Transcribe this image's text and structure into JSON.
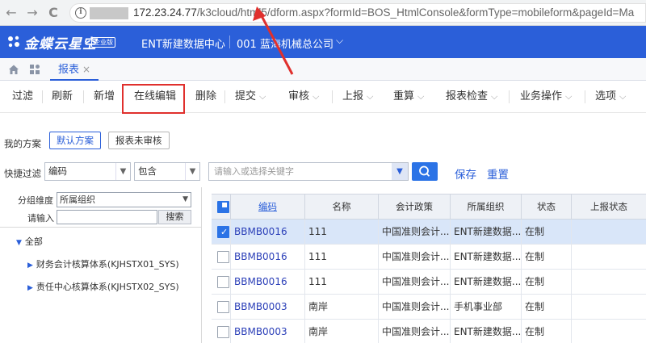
{
  "browser": {
    "back": "←",
    "forward": "→",
    "reload": "C",
    "info": "i",
    "url_host": "172.23.24.77",
    "url_path": "/k3cloud/html5/dform.aspx?formId=BOS_HtmlConsole&formType=mobileform&pageId=Ma"
  },
  "header": {
    "logo_text": "金蝶云星空",
    "logo_badge": "企业版",
    "data_center": "ENT新建数据中心",
    "org": "001 蓝海机械总公司",
    "org_caret": "⌵"
  },
  "tabs": {
    "active_label": "报表",
    "close": "×"
  },
  "toolbar": {
    "filter": "过滤",
    "refresh": "刷新",
    "add": "新增",
    "online_edit": "在线编辑",
    "delete": "删除",
    "submit": "提交",
    "audit": "审核",
    "report": "上报",
    "recalc": "重算",
    "check": "报表检查",
    "business": "业务操作",
    "options": "选项",
    "caret": "⌵"
  },
  "scheme": {
    "label": "我的方案",
    "default": "默认方案",
    "unaudited": "报表未审核"
  },
  "quick_filter": {
    "label": "快捷过滤",
    "field": "编码",
    "operator": "包含",
    "placeholder": "请输入或选择关键字",
    "save": "保存",
    "reset": "重置"
  },
  "left_panel": {
    "group_label": "分组维度",
    "group_value": "所属组织",
    "input_label": "请输入",
    "search_button": "搜索",
    "tree": [
      {
        "label": "全部"
      },
      {
        "label": "财务会计核算体系(KJHSTX01_SYS)"
      },
      {
        "label": "责任中心核算体系(KJHSTX02_SYS)"
      }
    ]
  },
  "grid": {
    "columns": [
      "编码",
      "名称",
      "会计政策",
      "所属组织",
      "状态",
      "上报状态"
    ],
    "rows": [
      {
        "code": "BBMB0016",
        "name": "111",
        "policy": "中国准则会计...",
        "org": "ENT新建数据...",
        "status": "在制",
        "report_status": "",
        "checked": true
      },
      {
        "code": "BBMB0016",
        "name": "111",
        "policy": "中国准则会计...",
        "org": "ENT新建数据...",
        "status": "在制",
        "report_status": "",
        "checked": false
      },
      {
        "code": "BBMB0016",
        "name": "111",
        "policy": "中国准则会计...",
        "org": "ENT新建数据...",
        "status": "在制",
        "report_status": "",
        "checked": false
      },
      {
        "code": "BBMB0003",
        "name": "南岸",
        "policy": "中国准则会计...",
        "org": "手机事业部",
        "status": "在制",
        "report_status": "",
        "checked": false
      },
      {
        "code": "BBMB0003",
        "name": "南岸",
        "policy": "中国准则会计...",
        "org": "ENT新建数据...",
        "status": "在制",
        "report_status": "",
        "checked": false
      }
    ]
  },
  "colors": {
    "brand": "#2b5fd9",
    "highlight": "#e0302d",
    "selected_row": "#d9e6f9"
  }
}
